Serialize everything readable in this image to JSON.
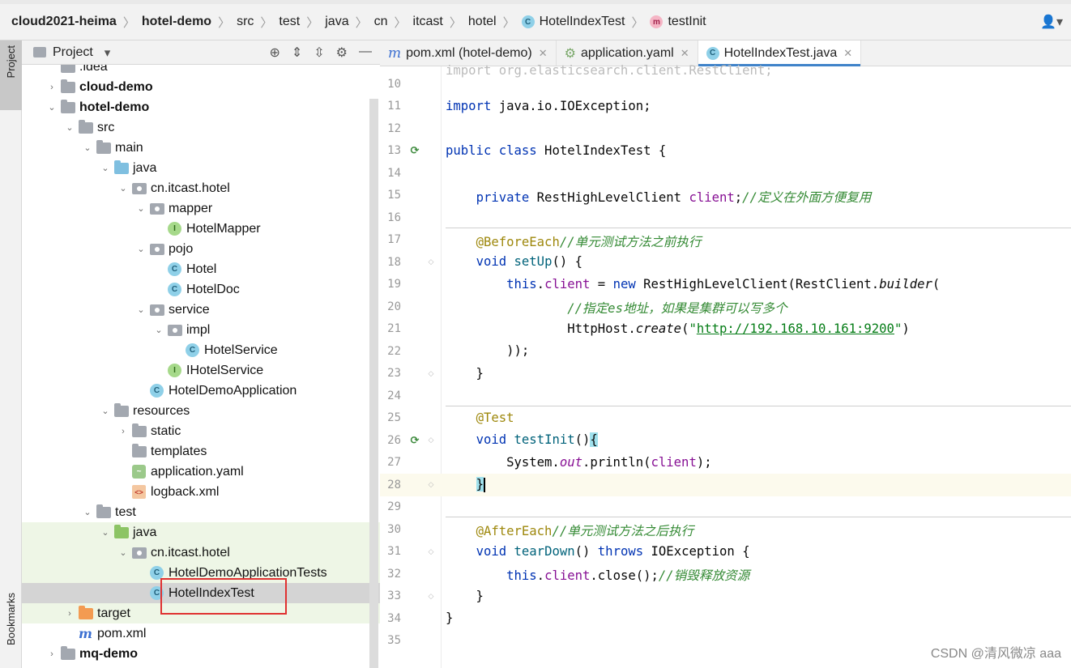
{
  "breadcrumb": {
    "items": [
      "cloud2021-heima",
      "hotel-demo",
      "src",
      "test",
      "java",
      "cn",
      "itcast",
      "hotel",
      "HotelIndexTest",
      "testInit"
    ]
  },
  "project_panel": {
    "title": "Project",
    "tree": [
      {
        "label": ".idea",
        "depth": 0,
        "type": "folder",
        "arrow": "",
        "bold": false
      },
      {
        "label": "cloud-demo",
        "depth": 0,
        "type": "folder",
        "arrow": "›",
        "bold": true
      },
      {
        "label": "hotel-demo",
        "depth": 0,
        "type": "folder",
        "arrow": "⌄",
        "bold": true
      },
      {
        "label": "src",
        "depth": 1,
        "type": "folder",
        "arrow": "⌄",
        "bold": false
      },
      {
        "label": "main",
        "depth": 2,
        "type": "folder",
        "arrow": "⌄",
        "bold": false
      },
      {
        "label": "java",
        "depth": 3,
        "type": "folder-blue",
        "arrow": "⌄",
        "bold": false
      },
      {
        "label": "cn.itcast.hotel",
        "depth": 4,
        "type": "pkg",
        "arrow": "⌄",
        "bold": false
      },
      {
        "label": "mapper",
        "depth": 5,
        "type": "pkg",
        "arrow": "⌄",
        "bold": false
      },
      {
        "label": "HotelMapper",
        "depth": 6,
        "type": "iface",
        "arrow": "",
        "bold": false
      },
      {
        "label": "pojo",
        "depth": 5,
        "type": "pkg",
        "arrow": "⌄",
        "bold": false
      },
      {
        "label": "Hotel",
        "depth": 6,
        "type": "class",
        "arrow": "",
        "bold": false
      },
      {
        "label": "HotelDoc",
        "depth": 6,
        "type": "class",
        "arrow": "",
        "bold": false
      },
      {
        "label": "service",
        "depth": 5,
        "type": "pkg",
        "arrow": "⌄",
        "bold": false
      },
      {
        "label": "impl",
        "depth": 6,
        "type": "pkg",
        "arrow": "⌄",
        "bold": false
      },
      {
        "label": "HotelService",
        "depth": 7,
        "type": "class",
        "arrow": "",
        "bold": false
      },
      {
        "label": "IHotelService",
        "depth": 6,
        "type": "iface",
        "arrow": "",
        "bold": false
      },
      {
        "label": "HotelDemoApplication",
        "depth": 5,
        "type": "class",
        "arrow": "",
        "bold": false
      },
      {
        "label": "resources",
        "depth": 3,
        "type": "folder",
        "arrow": "⌄",
        "bold": false
      },
      {
        "label": "static",
        "depth": 4,
        "type": "folder",
        "arrow": "›",
        "bold": false
      },
      {
        "label": "templates",
        "depth": 4,
        "type": "folder",
        "arrow": "",
        "bold": false
      },
      {
        "label": "application.yaml",
        "depth": 4,
        "type": "yaml",
        "arrow": "",
        "bold": false
      },
      {
        "label": "logback.xml",
        "depth": 4,
        "type": "xml",
        "arrow": "",
        "bold": false
      },
      {
        "label": "test",
        "depth": 2,
        "type": "folder",
        "arrow": "⌄",
        "bold": false
      },
      {
        "label": "java",
        "depth": 3,
        "type": "folder-green",
        "arrow": "⌄",
        "bold": false,
        "green": true
      },
      {
        "label": "cn.itcast.hotel",
        "depth": 4,
        "type": "pkg",
        "arrow": "⌄",
        "bold": false,
        "green": true
      },
      {
        "label": "HotelDemoApplicationTests",
        "depth": 5,
        "type": "class",
        "arrow": "",
        "bold": false,
        "green": true
      },
      {
        "label": "HotelIndexTest",
        "depth": 5,
        "type": "class",
        "arrow": "",
        "bold": false,
        "selected": true
      },
      {
        "label": "target",
        "depth": 1,
        "type": "folder-orange",
        "arrow": "›",
        "bold": false,
        "green": true
      },
      {
        "label": "pom.xml",
        "depth": 1,
        "type": "maven",
        "arrow": "",
        "bold": false
      },
      {
        "label": "mq-demo",
        "depth": 0,
        "type": "folder",
        "arrow": "›",
        "bold": true
      }
    ]
  },
  "side_labels": {
    "project": "Project",
    "bookmarks": "Bookmarks"
  },
  "tabs": [
    {
      "label": "pom.xml (hotel-demo)",
      "icon": "m",
      "active": false
    },
    {
      "label": "application.yaml",
      "icon": "yaml",
      "active": false
    },
    {
      "label": "HotelIndexTest.java",
      "icon": "c",
      "active": true
    }
  ],
  "editor": {
    "line_numbers": [
      "10",
      "11",
      "12",
      "13",
      "14",
      "15",
      "16",
      "17",
      "18",
      "19",
      "20",
      "21",
      "22",
      "23",
      "24",
      "25",
      "26",
      "27",
      "28",
      "29",
      "30",
      "31",
      "32",
      "33",
      "34",
      "35"
    ],
    "current_line": "28",
    "url": "http://192.168.10.161:9200",
    "comments": {
      "field": "//定义在外面方便复用",
      "before": "//单元测试方法之前执行",
      "es": "//指定es地址，如果是集群可以写多个",
      "after": "//单元测试方法之后执行",
      "close": "//销毁释放资源"
    }
  },
  "watermark": "CSDN @清风微凉 aaa"
}
